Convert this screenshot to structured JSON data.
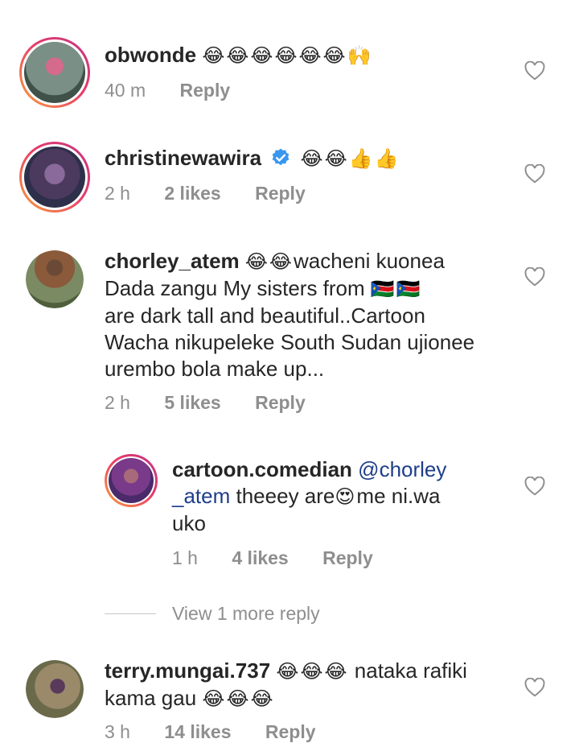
{
  "comments": [
    {
      "username": "obwonde",
      "text": "",
      "emoji": "😂😂😂😂😂😂🙌",
      "time": "40 m",
      "likes": "",
      "reply": "Reply"
    },
    {
      "username": "christinewawira",
      "emoji": "😂😂👍👍",
      "time": "2 h",
      "likes": "2 likes",
      "reply": "Reply"
    },
    {
      "username": "chorley_atem",
      "emoji_lead": "😂😂",
      "text_1": "wacheni kuonea",
      "text_2": "Dada zangu My sisters from",
      "flags": "🇸🇸🇸🇸",
      "text_3": "are dark tall and beautiful..Cartoon",
      "text_4": "Wacha nikupeleke South Sudan ujionee",
      "text_5": "urembo bola make up...",
      "time": "2 h",
      "likes": "5 likes",
      "reply": "Reply"
    },
    {
      "username": "cartoon.comedian",
      "mention_1": "@chorley",
      "mention_2": "_atem",
      "text_a": "theeey are",
      "emoji": "😍",
      "text_b": "me ni.wa",
      "text_c": "uko",
      "time": "1 h",
      "likes": "4 likes",
      "reply": "Reply"
    },
    {
      "username": "terry.mungai.737",
      "emoji_a": "😂😂😂",
      "text_1": "nataka rafiki",
      "text_2": "kama gau",
      "emoji_b": "😂😂😂",
      "time": "3 h",
      "likes": "14 likes",
      "reply": "Reply"
    }
  ],
  "view_more": "View 1 more reply",
  "colors": {
    "text": "#262626",
    "meta": "#8e8e8e",
    "mention": "#1d3e8a",
    "verified": "#3897f0"
  }
}
